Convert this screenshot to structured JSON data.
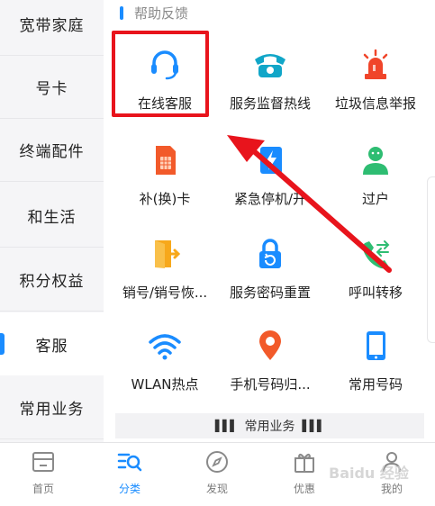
{
  "sidebar": {
    "items": [
      {
        "label": "宽带家庭"
      },
      {
        "label": "号卡"
      },
      {
        "label": "终端配件"
      },
      {
        "label": "和生活"
      },
      {
        "label": "积分权益"
      },
      {
        "label": "客服",
        "active": true
      },
      {
        "label": "常用业务"
      }
    ]
  },
  "section": {
    "title": "帮助反馈"
  },
  "grid": [
    {
      "label": "在线客服",
      "icon": "headset-icon"
    },
    {
      "label": "服务监督热线",
      "icon": "phone-icon"
    },
    {
      "label": "垃圾信息举报",
      "icon": "alarm-icon"
    },
    {
      "label": "补(换)卡",
      "icon": "sim-card-icon"
    },
    {
      "label": "紧急停机/开",
      "icon": "lightning-card-icon"
    },
    {
      "label": "过户",
      "icon": "transfer-user-icon"
    },
    {
      "label": "销号/销号恢...",
      "icon": "exit-door-icon"
    },
    {
      "label": "服务密码重置",
      "icon": "lock-reset-icon"
    },
    {
      "label": "呼叫转移",
      "icon": "call-forward-icon"
    },
    {
      "label": "WLAN热点",
      "icon": "wifi-icon"
    },
    {
      "label": "手机号码归...",
      "icon": "location-pin-icon"
    },
    {
      "label": "常用号码",
      "icon": "smartphone-icon"
    }
  ],
  "subsection": {
    "title": "常用业务"
  },
  "bottom_nav": [
    {
      "label": "首页",
      "icon": "home-icon"
    },
    {
      "label": "分类",
      "icon": "category-search-icon",
      "active": true
    },
    {
      "label": "发现",
      "icon": "compass-icon"
    },
    {
      "label": "优惠",
      "icon": "gift-icon"
    },
    {
      "label": "我的",
      "icon": "user-icon"
    }
  ],
  "colors": {
    "accent": "#1a8cff",
    "highlight": "#e8141c"
  },
  "watermark": "Baidu 经验"
}
